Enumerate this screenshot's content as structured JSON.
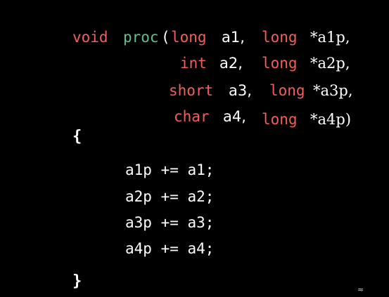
{
  "code": {
    "line1": {
      "ret_type": "void",
      "func_name": "proc",
      "open_paren": "(",
      "type1": "long",
      "arg1": "a1,",
      "type2": "long",
      "arg2": "*a1p,"
    },
    "line2": {
      "type1": "int",
      "arg1": "a2,",
      "type2": "long",
      "arg2": "*a2p,"
    },
    "line3": {
      "type1": "short",
      "arg1": "a3,",
      "type2": "long",
      "arg2": "*a3p,"
    },
    "line4": {
      "type1": "char",
      "arg1": "a4,",
      "type2": "long",
      "arg2": "*a4p)"
    },
    "open_brace": "{",
    "body": [
      "a1p += a1;",
      "a2p += a2;",
      "a3p += a3;",
      "a4p += a4;"
    ],
    "close_brace": "}"
  },
  "colors": {
    "background": "#000000",
    "keyword": "#f25d5d",
    "function_name": "#5fc08f",
    "text": "#ffffff"
  }
}
